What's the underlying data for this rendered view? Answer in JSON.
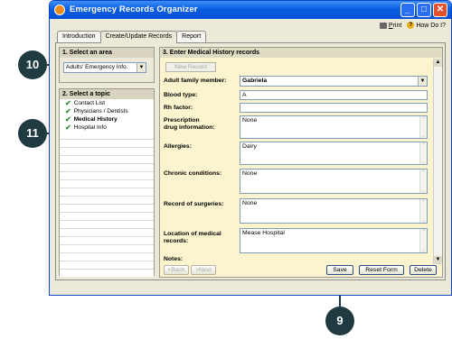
{
  "window": {
    "title": "Emergency Records Organizer",
    "controls": [
      "_",
      "□",
      "✕"
    ]
  },
  "toolbar": {
    "print_label": "Print",
    "help_label": "How Do I?"
  },
  "tabs": [
    {
      "label": "Introduction"
    },
    {
      "label": "Create/Update Records"
    },
    {
      "label": "Report"
    }
  ],
  "area": {
    "header": "1. Select an area",
    "selected": "Adults' Emergency Info."
  },
  "topic": {
    "header": "2. Select a topic",
    "items": [
      {
        "label": "Contact List"
      },
      {
        "label": "Physicians / Dentists"
      },
      {
        "label": "Medical History"
      },
      {
        "label": "Hospital Info"
      }
    ]
  },
  "records": {
    "header": "3. Enter Medical History records",
    "new_record_label": "New Record",
    "fields": {
      "member_label": "Adult family member:",
      "member_value": "Gabriela",
      "blood_label": "Blood type:",
      "blood_value": "A",
      "rh_label": "Rh factor:",
      "rh_value": "",
      "prescription_label_1": "Prescription",
      "prescription_label_2": "drug information:",
      "prescription_value": "None",
      "allergies_label": "Allergies:",
      "allergies_value": "Dairy",
      "chronic_label": "Chronic conditions:",
      "chronic_value": "None",
      "surgeries_label": "Record of surgeries:",
      "surgeries_value": "None",
      "location_label_1": "Location of medical",
      "location_label_2": "records:",
      "location_value": "Mease Hospital",
      "notes_label": "Notes:"
    },
    "buttons": {
      "back": "<Back",
      "next": ">Next",
      "save": "Save",
      "reset": "Reset Form",
      "delete": "Delete"
    }
  },
  "callouts": {
    "c10": "10",
    "c11": "11",
    "c9": "9"
  },
  "colors": {
    "titlebar": "#0a5fe0",
    "records_bg": "#fbf4cf",
    "callout": "#1f3a40",
    "check": "#2e8b2e"
  }
}
